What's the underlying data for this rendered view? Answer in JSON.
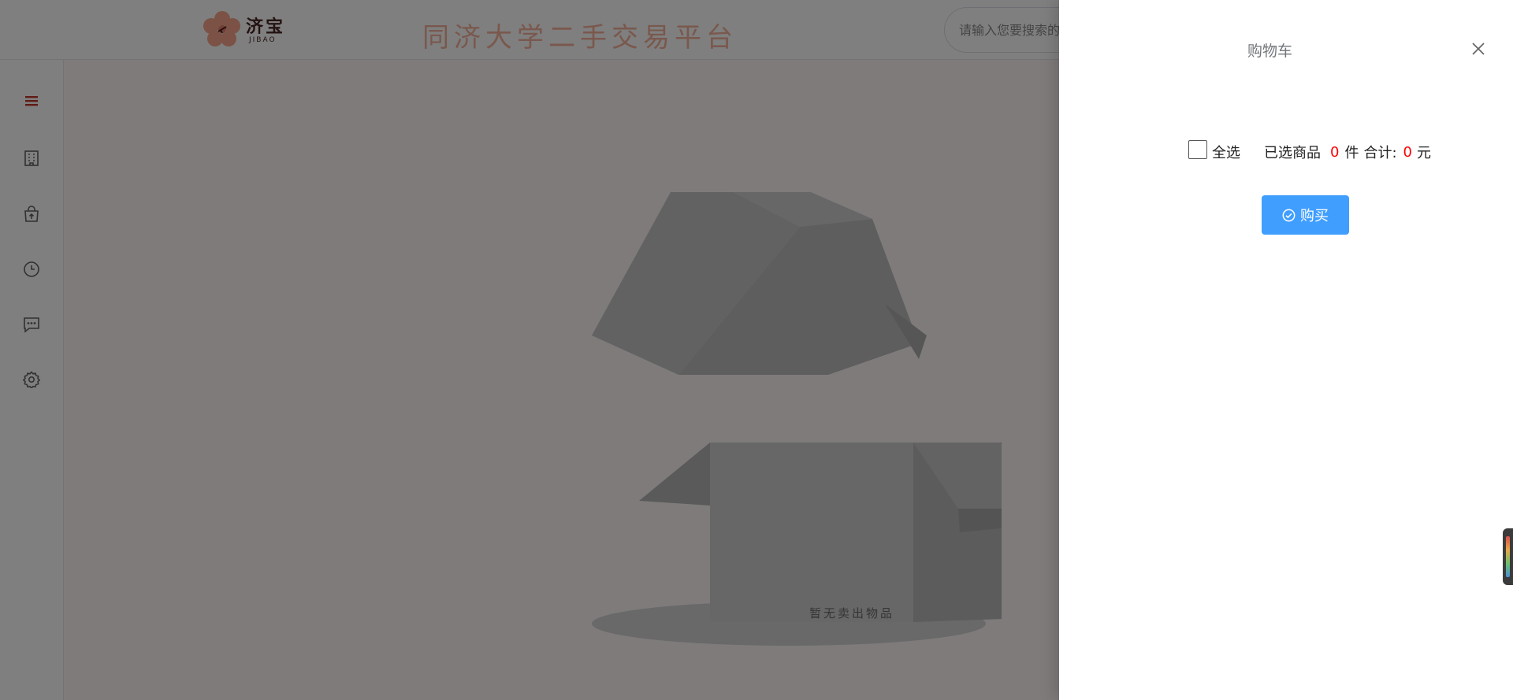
{
  "header": {
    "logo_text": "济宝",
    "logo_subtext": "JIBAO",
    "site_title": "同济大学二手交易平台",
    "search_placeholder": "请输入您要搜索的"
  },
  "sidebar": {
    "items": [
      {
        "icon": "menu-icon",
        "color": "#c0392b"
      },
      {
        "icon": "building-icon"
      },
      {
        "icon": "shopping-bag-icon"
      },
      {
        "icon": "clock-icon"
      },
      {
        "icon": "chat-icon"
      },
      {
        "icon": "gear-icon"
      }
    ]
  },
  "main": {
    "empty_text": "暂无卖出物品",
    "empty_icon": "open-box-icon"
  },
  "drawer": {
    "title": "购物车",
    "select_all_label": "全选",
    "selected_label": "已选商品",
    "selected_count": "0",
    "selected_unit": "件",
    "total_label": "合计:",
    "total_value": "0",
    "total_unit": "元",
    "buy_label": "购买"
  },
  "colors": {
    "accent": "#409eff",
    "highlight": "#ff0000",
    "title_pink": "#f5b09a"
  }
}
